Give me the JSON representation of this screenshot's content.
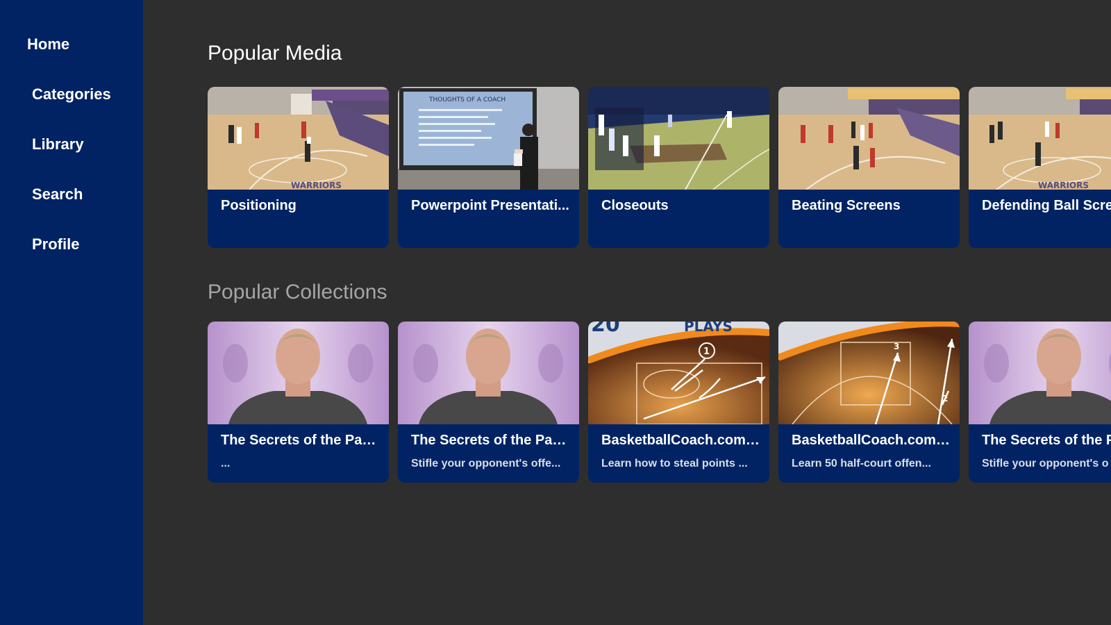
{
  "sidebar": {
    "items": [
      {
        "label": "Home"
      },
      {
        "label": "Categories"
      },
      {
        "label": "Library"
      },
      {
        "label": "Search"
      },
      {
        "label": "Profile"
      }
    ]
  },
  "colors": {
    "sidebar_bg": "#012364",
    "card_bg": "#012364",
    "page_bg": "#2e2e2e",
    "section_title_active": "#ffffff",
    "section_title_inactive": "#a6a6a6"
  },
  "popular_media": {
    "title": "Popular Media",
    "items": [
      {
        "title": "Positioning"
      },
      {
        "title": "Powerpoint Presentati..."
      },
      {
        "title": "Closeouts"
      },
      {
        "title": "Beating Screens"
      },
      {
        "title": "Defending Ball Scree"
      }
    ]
  },
  "popular_collections": {
    "title": "Popular Collections",
    "items": [
      {
        "title": "The Secrets of the Pac...",
        "subtitle": "..."
      },
      {
        "title": "The Secrets of the Pac...",
        "subtitle": "Stifle your opponent's offe..."
      },
      {
        "title": "BasketballCoach.com ...",
        "subtitle": "Learn how to steal points ..."
      },
      {
        "title": "BasketballCoach.com ...",
        "subtitle": "Learn 50 half-court offen..."
      },
      {
        "title": "The Secrets of the P",
        "subtitle": "Stifle your opponent's o"
      }
    ],
    "thumb_texts": {
      "plays_number": "20",
      "plays_word": "PLAYS",
      "circle_1": "1",
      "num_2": "2",
      "num_3": "3"
    }
  },
  "slide_heading": "THOUGHTS OF A COACH"
}
